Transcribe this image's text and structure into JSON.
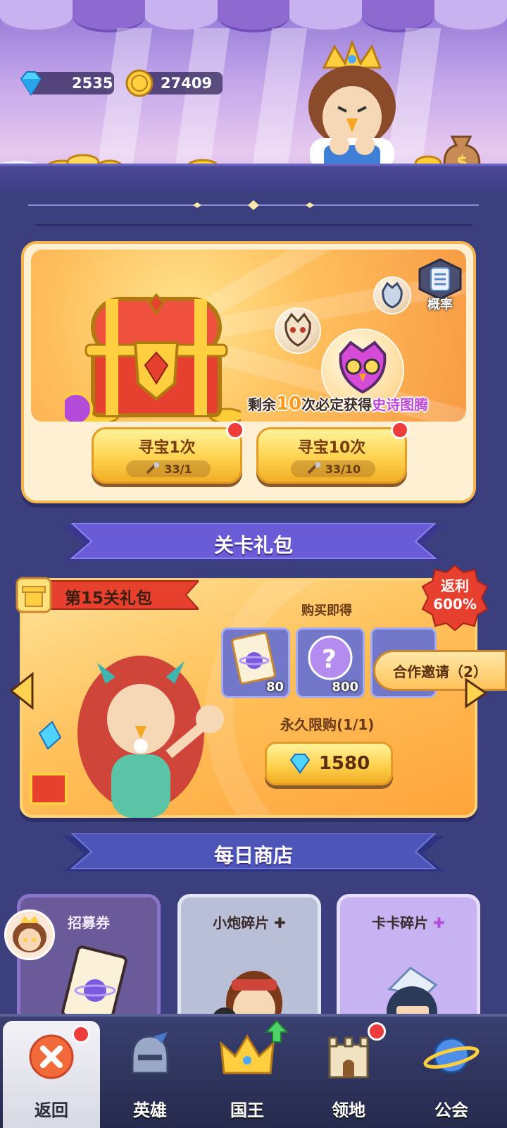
{
  "currencies": {
    "diamonds": "2535",
    "coins": "27409"
  },
  "treasure": {
    "probability_label": "概率",
    "guarantee_prefix": "剩余",
    "guarantee_count": "10",
    "guarantee_middle": "次必定获得",
    "guarantee_reward": "史诗图腾",
    "hunt_once": {
      "title": "寻宝1次",
      "cost": "33/1"
    },
    "hunt_ten": {
      "title": "寻宝10次",
      "cost": "33/10"
    }
  },
  "level_gift": {
    "section_title": "关卡礼包",
    "tag": "第15关礼包",
    "rebate_line1": "返利",
    "rebate_line2": "600%",
    "buy_get": "购买即得",
    "items": [
      {
        "icon": "scroll-ticket-icon",
        "qty": "80"
      },
      {
        "icon": "mystery-orb-icon",
        "qty": "800"
      }
    ],
    "limit": "永久限购(1/1)",
    "price": "1580",
    "coop_invite": "合作邀请（2）"
  },
  "daily_shop": {
    "section_title": "每日商店",
    "cards": [
      {
        "name": "招募券"
      },
      {
        "name": "小炮碎片"
      },
      {
        "name": "卡卡碎片"
      }
    ]
  },
  "nav": [
    {
      "label": "返回",
      "icon": "close-icon"
    },
    {
      "label": "英雄",
      "icon": "helmet-icon"
    },
    {
      "label": "国王",
      "icon": "crown-icon"
    },
    {
      "label": "领地",
      "icon": "castle-icon"
    },
    {
      "label": "公会",
      "icon": "planet-icon"
    }
  ],
  "colors": {
    "background": "#3c3f7e",
    "accent_gold": "#ffd24f",
    "section_ribbon": "#6a5bd6",
    "notification_red": "#ee3b3b",
    "epic_purple": "#c04ad8"
  }
}
